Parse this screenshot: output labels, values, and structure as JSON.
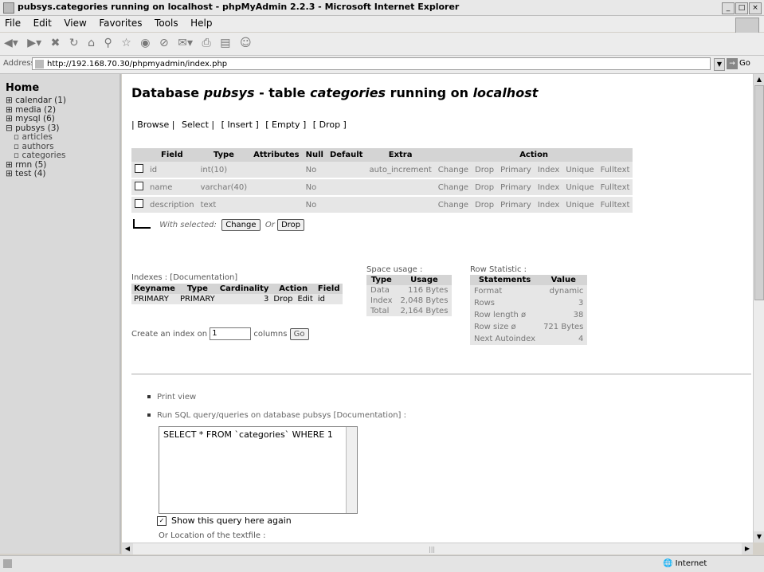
{
  "window": {
    "title": "pubsys.categories running on localhost - phpMyAdmin 2.2.3 - Microsoft Internet Explorer"
  },
  "menu": [
    "File",
    "Edit",
    "View",
    "Favorites",
    "Tools",
    "Help"
  ],
  "address": {
    "label": "Address",
    "url": "http://192.168.70.30/phpmyadmin/index.php",
    "go": "Go"
  },
  "sidebar": {
    "home": "Home",
    "databases": [
      {
        "label": "calendar (1)"
      },
      {
        "label": "media (2)"
      },
      {
        "label": "mysql (6)"
      },
      {
        "label": "pubsys (3)"
      },
      {
        "label": "articles",
        "table": true
      },
      {
        "label": "authors",
        "table": true
      },
      {
        "label": "categories",
        "table": true
      },
      {
        "label": "rmn (5)"
      },
      {
        "label": "test (4)"
      }
    ]
  },
  "heading": {
    "prefix": "Database ",
    "db": "pubsys",
    "mid": " - table ",
    "table": "categories",
    "mid2": " running on ",
    "host": "localhost"
  },
  "tabs": [
    "| Browse |",
    "Select |",
    "[ Insert ]",
    "[ Empty ]",
    "[ Drop ]"
  ],
  "fields_table": {
    "headers": [
      "Field",
      "Type",
      "Attributes",
      "Null",
      "Default",
      "Extra",
      "Action"
    ],
    "actions": [
      "Change",
      "Drop",
      "Primary",
      "Index",
      "Unique",
      "Fulltext"
    ],
    "rows": [
      {
        "field": "id",
        "type": "int(10)",
        "attributes": "",
        "null": "No",
        "default": "",
        "extra": "auto_increment"
      },
      {
        "field": "name",
        "type": "varchar(40)",
        "attributes": "",
        "null": "No",
        "default": "",
        "extra": ""
      },
      {
        "field": "description",
        "type": "text",
        "attributes": "",
        "null": "No",
        "default": "",
        "extra": ""
      }
    ]
  },
  "with_selected": {
    "label": "With selected:",
    "change": "Change",
    "or": "Or",
    "drop": "Drop"
  },
  "indexes": {
    "title": "Indexes : [Documentation]",
    "headers": [
      "Keyname",
      "Type",
      "Cardinality",
      "Action",
      "Field"
    ],
    "rows": [
      {
        "keyname": "PRIMARY",
        "type": "PRIMARY",
        "cardinality": "3",
        "drop": "Drop",
        "edit": "Edit",
        "field": "id"
      }
    ],
    "create_prefix": "Create an index on",
    "create_value": "1",
    "create_suffix": "columns",
    "go": "Go"
  },
  "space_usage": {
    "title": "Space usage :",
    "headers": [
      "Type",
      "Usage"
    ],
    "rows": [
      {
        "type": "Data",
        "usage": "116 Bytes"
      },
      {
        "type": "Index",
        "usage": "2,048 Bytes"
      },
      {
        "type": "Total",
        "usage": "2,164 Bytes"
      }
    ]
  },
  "row_statistic": {
    "title": "Row Statistic :",
    "headers": [
      "Statements",
      "Value"
    ],
    "rows": [
      {
        "statement": "Format",
        "value": "dynamic"
      },
      {
        "statement": "Rows",
        "value": "3"
      },
      {
        "statement": "Row length ø",
        "value": "38"
      },
      {
        "statement": "Row size ø",
        "value": "721 Bytes"
      },
      {
        "statement": "Next Autoindex",
        "value": "4"
      }
    ]
  },
  "bottom": {
    "print_view": "Print view",
    "run_sql": "Run SQL query/queries on database pubsys [Documentation] :",
    "sql_text": "SELECT * FROM `categories` WHERE 1",
    "show_query": "Show this query here again",
    "or_location": "Or Location of the textfile :"
  },
  "status": {
    "zone": "Internet"
  }
}
